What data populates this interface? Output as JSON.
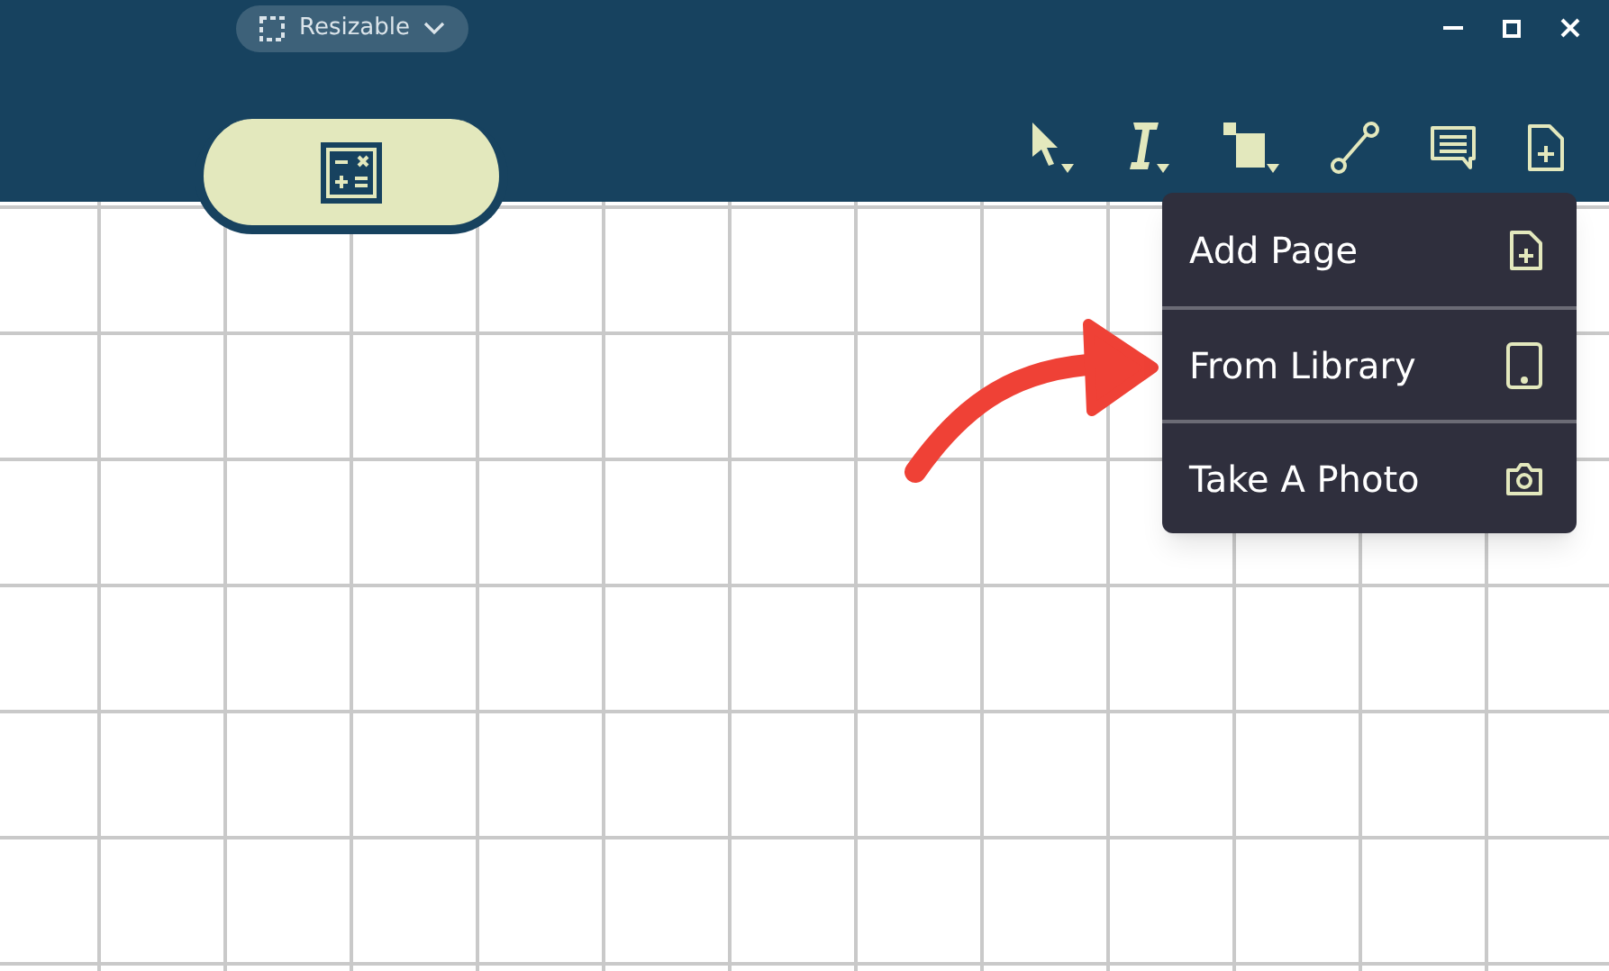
{
  "window_mode": {
    "label": "Resizable"
  },
  "add_menu": {
    "items": [
      {
        "label": "Add Page",
        "kind": "page"
      },
      {
        "label": "From Library",
        "kind": "tablet"
      },
      {
        "label": "Take A Photo",
        "kind": "camera"
      }
    ]
  }
}
